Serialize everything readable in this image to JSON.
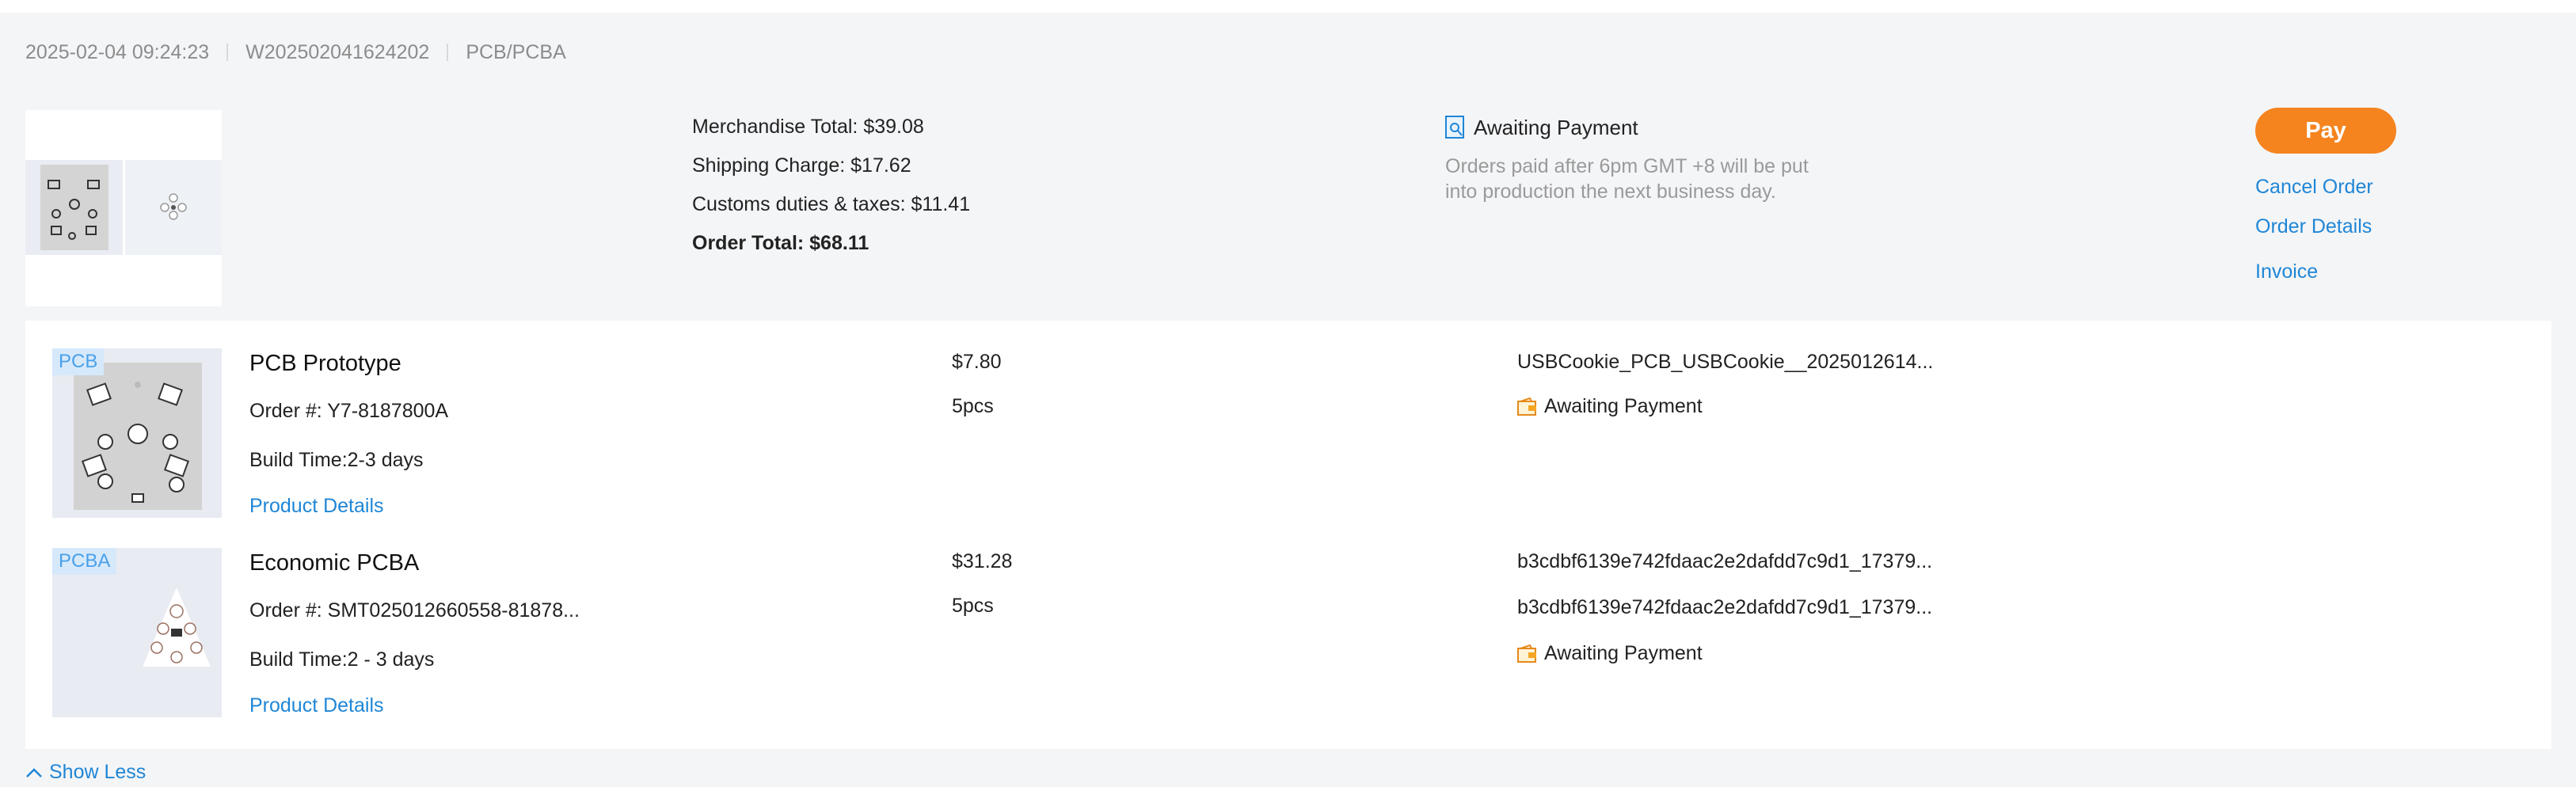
{
  "order": {
    "datetime": "2025-02-04 09:24:23",
    "order_id": "W202502041624202",
    "category": "PCB/PCBA"
  },
  "summary": {
    "merchandise_total": "Merchandise Total: $39.08",
    "shipping_charge": "Shipping Charge: $17.62",
    "customs": "Customs duties & taxes: $11.41",
    "order_total": "Order Total: $68.11",
    "status": "Awaiting Payment",
    "note": "Orders paid after 6pm GMT +8 will be put into production the next business day."
  },
  "actions": {
    "pay": "Pay",
    "cancel": "Cancel Order",
    "details": "Order Details",
    "invoice": "Invoice"
  },
  "items": [
    {
      "tag": "PCB",
      "name": "PCB Prototype",
      "order_no": "Order #: Y7-8187800A",
      "build_time": "Build Time:2-3 days",
      "details_link": "Product Details",
      "price": "$7.80",
      "qty": "5pcs",
      "file": "USBCookie_PCB_USBCookie__2025012614...",
      "status": "Awaiting Payment"
    },
    {
      "tag": "PCBA",
      "name": "Economic PCBA",
      "order_no": "Order #: SMT025012660558-81878...",
      "build_time": "Build Time:2 - 3 days",
      "details_link": "Product Details",
      "price": "$31.28",
      "qty": "5pcs",
      "file": "b3cdbf6139e742fdaac2e2dafdd7c9d1_17379...",
      "file2": "b3cdbf6139e742fdaac2e2dafdd7c9d1_17379...",
      "status": "Awaiting Payment"
    }
  ],
  "show_less": "Show Less",
  "colors": {
    "accent_orange": "#f5841f",
    "link_blue": "#1f86d6",
    "tag_blue": "#4aa0e8"
  }
}
